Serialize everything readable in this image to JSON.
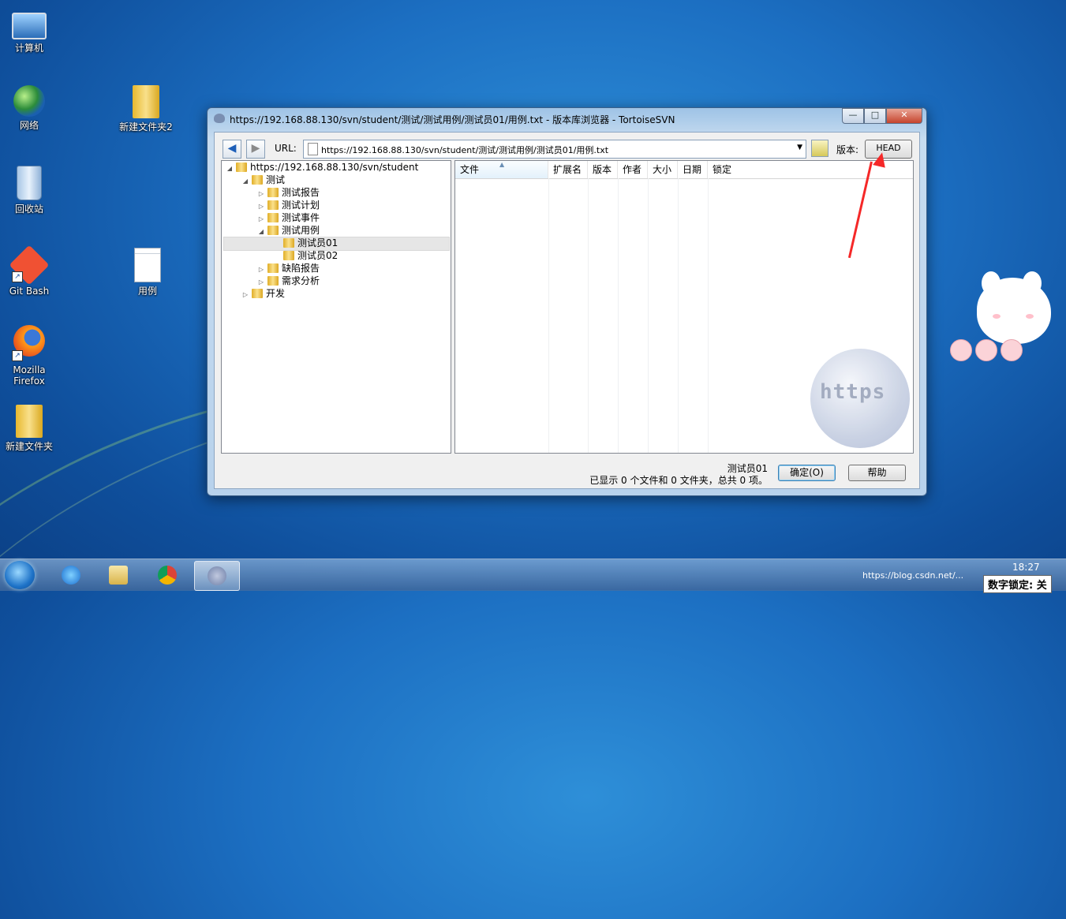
{
  "desktop": {
    "icons": [
      {
        "label": "计算机",
        "icon": "computer-icon"
      },
      {
        "label": "网络",
        "icon": "network-icon"
      },
      {
        "label": "回收站",
        "icon": "recycle-bin-icon"
      },
      {
        "label": "Git Bash",
        "icon": "git-bash-icon"
      },
      {
        "label": "Mozilla Firefox",
        "icon": "firefox-icon"
      },
      {
        "label": "新建文件夹",
        "icon": "folder-icon"
      },
      {
        "label": "新建文件夹2",
        "icon": "folder-icon"
      },
      {
        "label": "用例",
        "icon": "text-file-icon"
      }
    ]
  },
  "window": {
    "title": "https://192.168.88.130/svn/student/测试/测试用例/测试员01/用例.txt - 版本库浏览器 - TortoiseSVN",
    "buttons": {
      "minimize": "—",
      "maximize": "□",
      "close": "✕"
    }
  },
  "toolbar": {
    "url_label": "URL:",
    "url_value": "https://192.168.88.130/svn/student/测试/测试用例/测试员01/用例.txt",
    "revision_label": "版本:",
    "revision_button": "HEAD"
  },
  "tree": {
    "root": "https://192.168.88.130/svn/student",
    "nodes": [
      {
        "label": "测试"
      },
      {
        "label": "测试报告"
      },
      {
        "label": "测试计划"
      },
      {
        "label": "测试事件"
      },
      {
        "label": "测试用例"
      },
      {
        "label": "测试员01"
      },
      {
        "label": "测试员02"
      },
      {
        "label": "缺陷报告"
      },
      {
        "label": "需求分析"
      },
      {
        "label": "开发"
      }
    ]
  },
  "list": {
    "columns": [
      "文件",
      "扩展名",
      "版本",
      "作者",
      "大小",
      "日期",
      "锁定"
    ],
    "rows": []
  },
  "status": {
    "selected": "测试员01",
    "summary": "已显示 0 个文件和 0 文件夹，总共 0 项。"
  },
  "dialog_buttons": {
    "ok": "确定(O)",
    "help": "帮助"
  },
  "watermark_text": "https",
  "taskbar": {
    "clock": "18:27",
    "tray_text": "https://blog.csdn.net/...",
    "numlock": "数字锁定: 关",
    "pinned": [
      "internet-explorer-icon",
      "file-explorer-icon",
      "chrome-icon",
      "tortoisesvn-icon"
    ]
  },
  "colors": {
    "accent_arrow": "#f52828",
    "desktop_blue": "#1c6fc2"
  }
}
